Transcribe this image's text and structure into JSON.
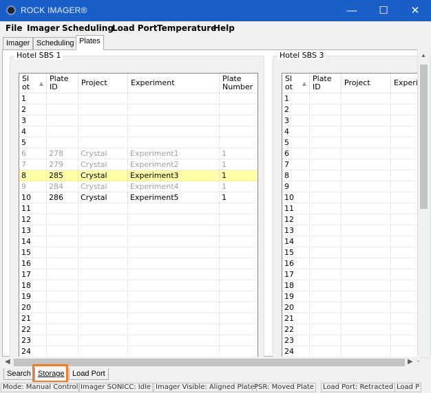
{
  "window": {
    "title": "ROCK IMAGER®",
    "minimize": "—",
    "maximize": "☐",
    "close": "✕"
  },
  "menu": [
    "File",
    "Imager",
    "Scheduling",
    "Load Port",
    "Temperature",
    "Help"
  ],
  "top_tabs": [
    {
      "label": "Imager",
      "active": false
    },
    {
      "label": "Scheduling",
      "active": false
    },
    {
      "label": "Plates",
      "active": true
    }
  ],
  "hotel_left": {
    "title": "Hotel SBS 1",
    "columns": [
      "Sl\not",
      "Plate\nID",
      "Project",
      "Experiment",
      "Plate\nNumber"
    ],
    "rows": [
      {
        "slot": "1",
        "plate_id": "",
        "project": "",
        "experiment": "",
        "plate_number": "",
        "state": "empty"
      },
      {
        "slot": "2",
        "plate_id": "",
        "project": "",
        "experiment": "",
        "plate_number": "",
        "state": "empty"
      },
      {
        "slot": "3",
        "plate_id": "",
        "project": "",
        "experiment": "",
        "plate_number": "",
        "state": "empty"
      },
      {
        "slot": "4",
        "plate_id": "",
        "project": "",
        "experiment": "",
        "plate_number": "",
        "state": "empty"
      },
      {
        "slot": "5",
        "plate_id": "",
        "project": "",
        "experiment": "",
        "plate_number": "",
        "state": "empty"
      },
      {
        "slot": "6",
        "plate_id": "278",
        "project": "Crystal",
        "experiment": "Experiment1",
        "plate_number": "1",
        "state": "dim"
      },
      {
        "slot": "7",
        "plate_id": "279",
        "project": "Crystal",
        "experiment": "Experiment2",
        "plate_number": "1",
        "state": "dim"
      },
      {
        "slot": "8",
        "plate_id": "285",
        "project": "Crystal",
        "experiment": "Experiment3",
        "plate_number": "1",
        "state": "selected"
      },
      {
        "slot": "9",
        "plate_id": "284",
        "project": "Crystal",
        "experiment": "Experiment4",
        "plate_number": "1",
        "state": "dim"
      },
      {
        "slot": "10",
        "plate_id": "286",
        "project": "Crystal",
        "experiment": "Experiment5",
        "plate_number": "1",
        "state": "normal"
      },
      {
        "slot": "11",
        "plate_id": "",
        "project": "",
        "experiment": "",
        "plate_number": "",
        "state": "empty"
      },
      {
        "slot": "12",
        "plate_id": "",
        "project": "",
        "experiment": "",
        "plate_number": "",
        "state": "empty"
      },
      {
        "slot": "13",
        "plate_id": "",
        "project": "",
        "experiment": "",
        "plate_number": "",
        "state": "empty"
      },
      {
        "slot": "14",
        "plate_id": "",
        "project": "",
        "experiment": "",
        "plate_number": "",
        "state": "empty"
      },
      {
        "slot": "15",
        "plate_id": "",
        "project": "",
        "experiment": "",
        "plate_number": "",
        "state": "empty"
      },
      {
        "slot": "16",
        "plate_id": "",
        "project": "",
        "experiment": "",
        "plate_number": "",
        "state": "empty"
      },
      {
        "slot": "17",
        "plate_id": "",
        "project": "",
        "experiment": "",
        "plate_number": "",
        "state": "empty"
      },
      {
        "slot": "18",
        "plate_id": "",
        "project": "",
        "experiment": "",
        "plate_number": "",
        "state": "empty"
      },
      {
        "slot": "19",
        "plate_id": "",
        "project": "",
        "experiment": "",
        "plate_number": "",
        "state": "empty"
      },
      {
        "slot": "20",
        "plate_id": "",
        "project": "",
        "experiment": "",
        "plate_number": "",
        "state": "empty"
      },
      {
        "slot": "21",
        "plate_id": "",
        "project": "",
        "experiment": "",
        "plate_number": "",
        "state": "empty"
      },
      {
        "slot": "22",
        "plate_id": "",
        "project": "",
        "experiment": "",
        "plate_number": "",
        "state": "empty"
      },
      {
        "slot": "23",
        "plate_id": "",
        "project": "",
        "experiment": "",
        "plate_number": "",
        "state": "empty"
      },
      {
        "slot": "24",
        "plate_id": "",
        "project": "",
        "experiment": "",
        "plate_number": "",
        "state": "empty"
      }
    ]
  },
  "hotel_right": {
    "title": "Hotel SBS 3",
    "columns": [
      "Sl\not",
      "Plate\nID",
      "Project",
      "Experi"
    ],
    "rows": [
      "1",
      "2",
      "3",
      "4",
      "5",
      "6",
      "7",
      "8",
      "9",
      "10",
      "11",
      "12",
      "13",
      "14",
      "15",
      "16",
      "17",
      "18",
      "19",
      "20",
      "21",
      "22",
      "23",
      "24"
    ]
  },
  "bottom_tabs": [
    {
      "label": "Search",
      "active": false
    },
    {
      "label": "Storage",
      "active": true
    },
    {
      "label": "Load Port",
      "active": false
    }
  ],
  "status": [
    "Mode: Manual Control",
    "Imager SONICC: Idle",
    "Imager Visible: Aligned Plate",
    "PSR: Moved Plate",
    "Load Port: Retracted",
    "Load P"
  ]
}
